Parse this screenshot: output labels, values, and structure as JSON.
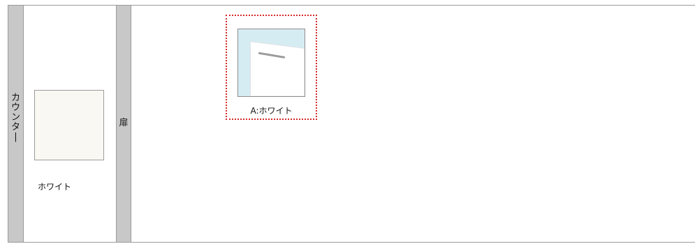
{
  "sections": {
    "counter": {
      "label": "カウンター",
      "swatch": {
        "name": "ホワイト",
        "color": "#faf8f3"
      }
    },
    "door": {
      "label": "扉",
      "options": [
        {
          "name": "A:ホワイト",
          "selected": true,
          "panel_color": "#ffffff",
          "background_color": "#d6ecf3",
          "handle": "bar-handle"
        }
      ]
    }
  },
  "colors": {
    "label_column": "#c8c8c8",
    "selection_border": "#d62828",
    "frame_border": "#9a9a9a"
  }
}
